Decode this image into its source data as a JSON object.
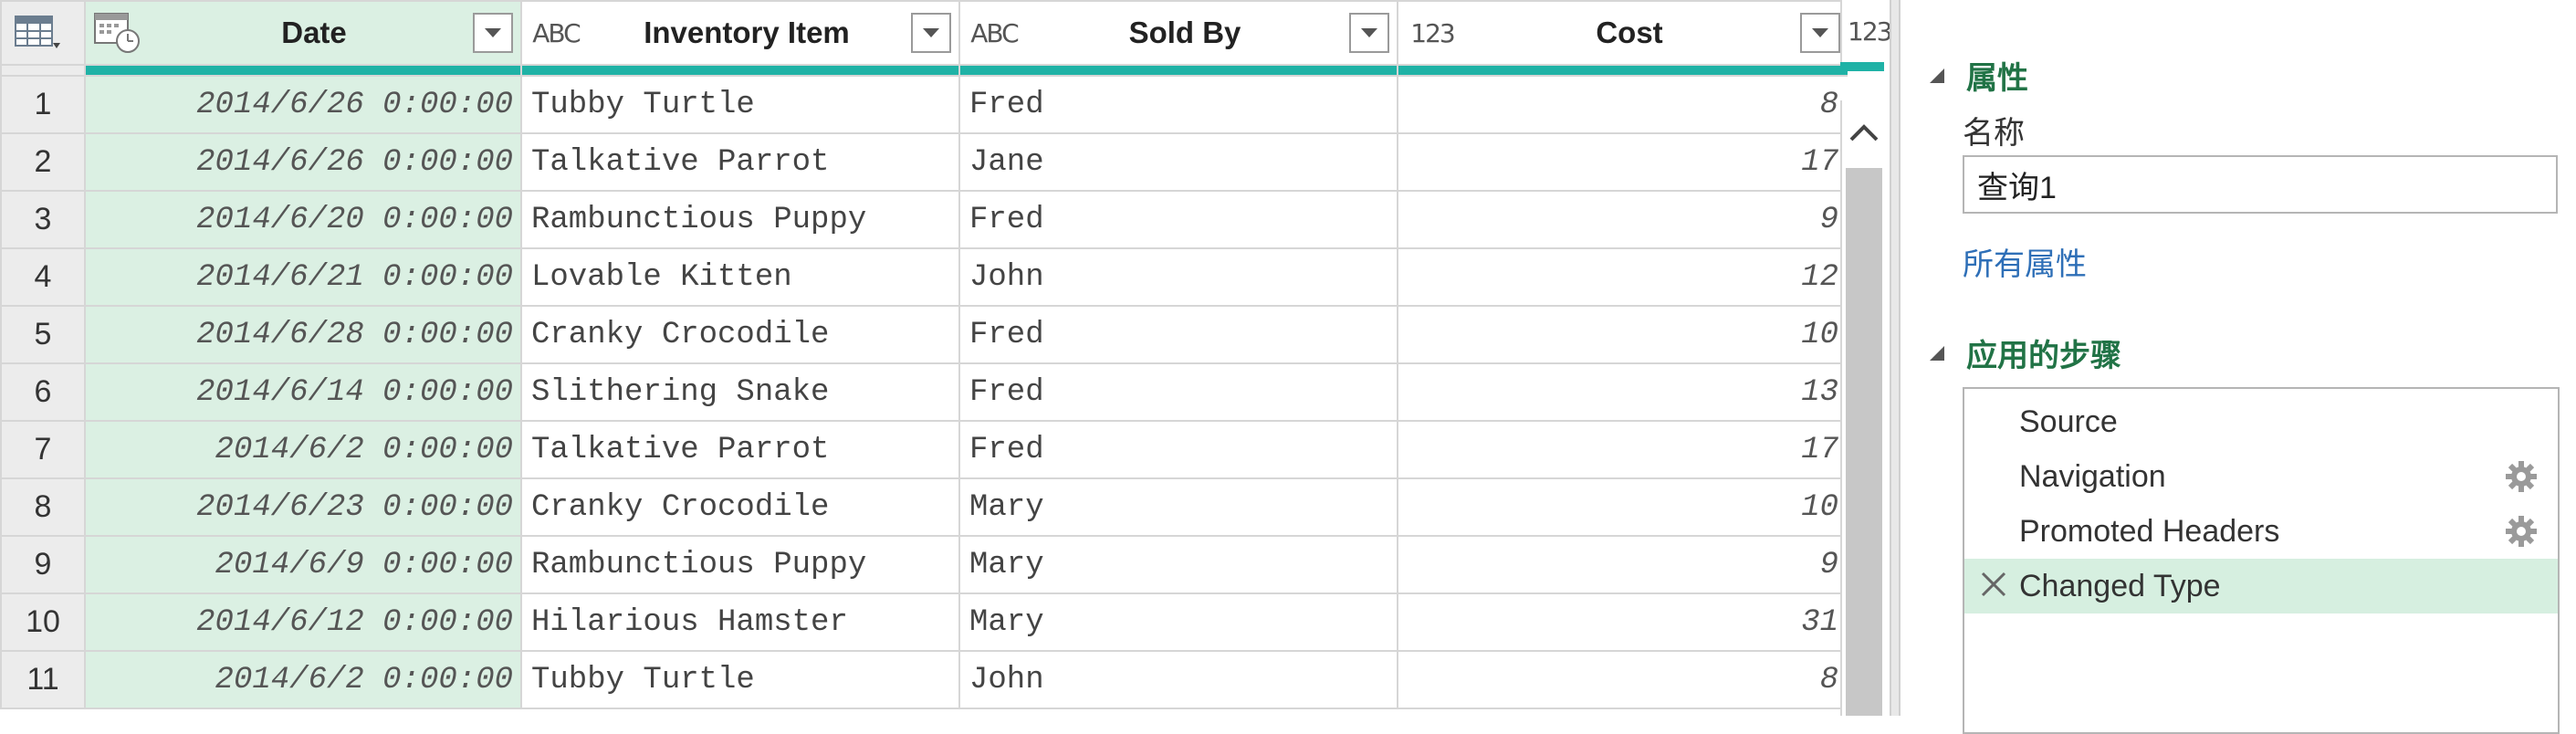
{
  "grid": {
    "columns": [
      {
        "type_glyph": "",
        "name": "Date"
      },
      {
        "type_glyph": "ABC",
        "name": "Inventory Item"
      },
      {
        "type_glyph": "ABC",
        "name": "Sold By"
      },
      {
        "type_glyph": "123",
        "name": "Cost"
      }
    ],
    "extra_col_type_glyph": "123",
    "rows": [
      {
        "n": "1",
        "date": "2014/6/26 0:00:00",
        "item": "Tubby Turtle",
        "sold_by": "Fred",
        "cost": "8"
      },
      {
        "n": "2",
        "date": "2014/6/26 0:00:00",
        "item": "Talkative Parrot",
        "sold_by": "Jane",
        "cost": "17"
      },
      {
        "n": "3",
        "date": "2014/6/20 0:00:00",
        "item": "Rambunctious Puppy",
        "sold_by": "Fred",
        "cost": "9"
      },
      {
        "n": "4",
        "date": "2014/6/21 0:00:00",
        "item": "Lovable Kitten",
        "sold_by": "John",
        "cost": "12"
      },
      {
        "n": "5",
        "date": "2014/6/28 0:00:00",
        "item": "Cranky Crocodile",
        "sold_by": "Fred",
        "cost": "10"
      },
      {
        "n": "6",
        "date": "2014/6/14 0:00:00",
        "item": "Slithering Snake",
        "sold_by": "Fred",
        "cost": "13"
      },
      {
        "n": "7",
        "date": "2014/6/2 0:00:00",
        "item": "Talkative Parrot",
        "sold_by": "Fred",
        "cost": "17"
      },
      {
        "n": "8",
        "date": "2014/6/23 0:00:00",
        "item": "Cranky Crocodile",
        "sold_by": "Mary",
        "cost": "10"
      },
      {
        "n": "9",
        "date": "2014/6/9 0:00:00",
        "item": "Rambunctious Puppy",
        "sold_by": "Mary",
        "cost": "9"
      },
      {
        "n": "10",
        "date": "2014/6/12 0:00:00",
        "item": "Hilarious Hamster",
        "sold_by": "Mary",
        "cost": "31"
      },
      {
        "n": "11",
        "date": "2014/6/2 0:00:00",
        "item": "Tubby Turtle",
        "sold_by": "John",
        "cost": "8"
      }
    ]
  },
  "pane": {
    "properties_title": "属性",
    "name_label": "名称",
    "name_value": "查询1",
    "all_properties": "所有属性",
    "steps_title": "应用的步骤",
    "steps": [
      {
        "label": "Source",
        "has_gear": false,
        "selected": false
      },
      {
        "label": "Navigation",
        "has_gear": true,
        "selected": false
      },
      {
        "label": "Promoted Headers",
        "has_gear": true,
        "selected": false
      },
      {
        "label": "Changed Type",
        "has_gear": false,
        "selected": true
      }
    ]
  },
  "colors": {
    "accent_bar": "#1fb2a6",
    "selected_step": "#d6efe0",
    "section_title": "#217346",
    "link": "#2e6fb7"
  }
}
